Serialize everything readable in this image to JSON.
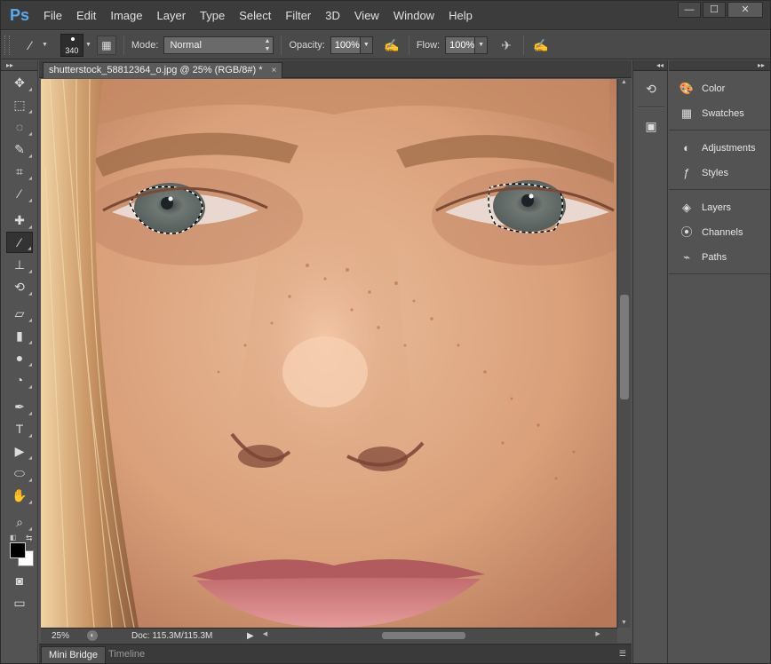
{
  "app": {
    "logo": "Ps"
  },
  "menu": [
    "File",
    "Edit",
    "Image",
    "Layer",
    "Type",
    "Select",
    "Filter",
    "3D",
    "View",
    "Window",
    "Help"
  ],
  "window_controls": {
    "minimize": "—",
    "maximize": "☐",
    "close": "✕"
  },
  "options": {
    "brush_size": "340",
    "mode_label": "Mode:",
    "mode_value": "Normal",
    "opacity_label": "Opacity:",
    "opacity_value": "100%",
    "flow_label": "Flow:",
    "flow_value": "100%"
  },
  "document": {
    "tab_title": "shutterstock_58812364_o.jpg @ 25% (RGB/8#) *",
    "close": "×"
  },
  "status": {
    "zoom": "25%",
    "doc_size": "Doc: 115.3M/115.3M"
  },
  "bottom_tabs": [
    "Mini Bridge",
    "Timeline"
  ],
  "tools": [
    {
      "name": "move-tool",
      "glyph": "✥"
    },
    {
      "name": "marquee-tool",
      "glyph": "⬚"
    },
    {
      "name": "lasso-tool",
      "glyph": "◌"
    },
    {
      "name": "quick-selection-tool",
      "glyph": "✎"
    },
    {
      "name": "crop-tool",
      "glyph": "⌗"
    },
    {
      "name": "eyedropper-tool",
      "glyph": "⁄"
    },
    {
      "name": "healing-brush-tool",
      "glyph": "✚"
    },
    {
      "name": "brush-tool",
      "glyph": "⁄",
      "active": true
    },
    {
      "name": "clone-stamp-tool",
      "glyph": "⊥"
    },
    {
      "name": "history-brush-tool",
      "glyph": "⟲"
    },
    {
      "name": "eraser-tool",
      "glyph": "▱"
    },
    {
      "name": "gradient-tool",
      "glyph": "▮"
    },
    {
      "name": "blur-tool",
      "glyph": "●"
    },
    {
      "name": "dodge-tool",
      "glyph": "◔"
    },
    {
      "name": "pen-tool",
      "glyph": "✒"
    },
    {
      "name": "type-tool",
      "glyph": "T"
    },
    {
      "name": "path-selection-tool",
      "glyph": "▶"
    },
    {
      "name": "ellipse-tool",
      "glyph": "⬭"
    },
    {
      "name": "hand-tool",
      "glyph": "✋"
    },
    {
      "name": "zoom-tool",
      "glyph": "⌕"
    }
  ],
  "panels": {
    "group1": [
      {
        "label": "Color",
        "icon": "color-palette-icon"
      },
      {
        "label": "Swatches",
        "icon": "swatches-grid-icon"
      }
    ],
    "group2": [
      {
        "label": "Adjustments",
        "icon": "adjustments-icon"
      },
      {
        "label": "Styles",
        "icon": "styles-fx-icon"
      }
    ],
    "group3": [
      {
        "label": "Layers",
        "icon": "layers-icon"
      },
      {
        "label": "Channels",
        "icon": "channels-icon"
      },
      {
        "label": "Paths",
        "icon": "paths-icon"
      }
    ]
  },
  "colors": {
    "foreground": "#000000",
    "background": "#ffffff",
    "ps_blue": "#5aa8ee"
  }
}
